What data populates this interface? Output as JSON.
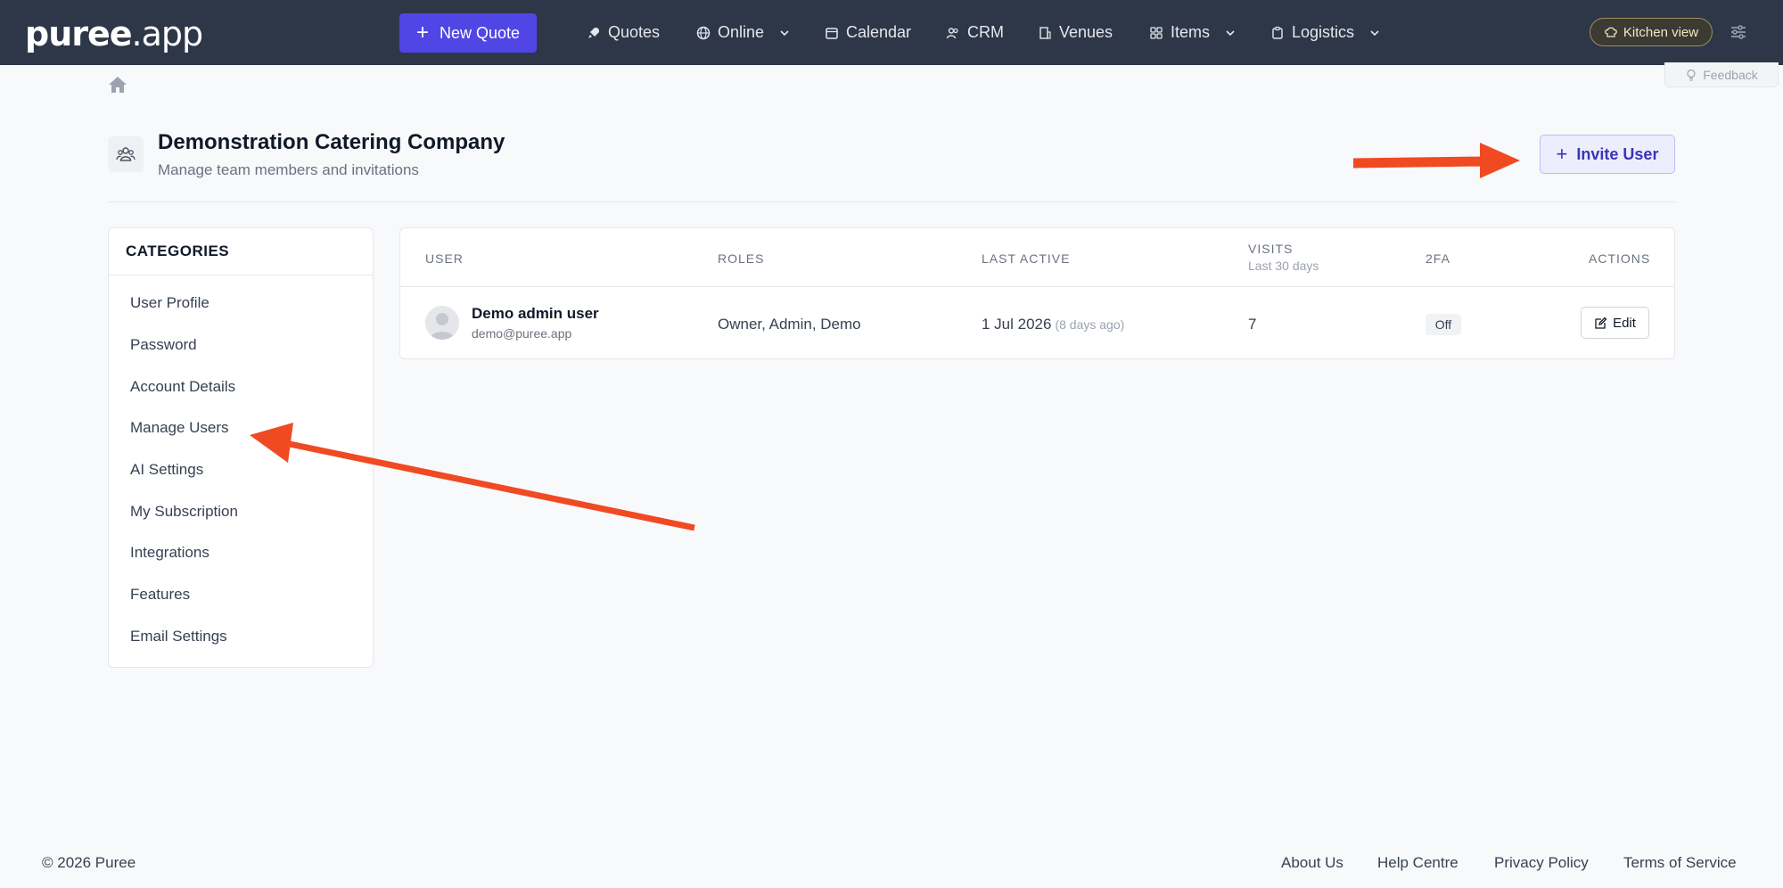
{
  "brand": {
    "logo_main": "puree",
    "logo_suffix": ".app"
  },
  "nav": {
    "new_quote": "New Quote",
    "items": [
      {
        "label": "Quotes",
        "icon": "rocket-icon"
      },
      {
        "label": "Online",
        "icon": "globe-icon",
        "dropdown": true
      },
      {
        "label": "Calendar",
        "icon": "calendar-icon"
      },
      {
        "label": "CRM",
        "icon": "users-icon"
      },
      {
        "label": "Venues",
        "icon": "building-icon"
      },
      {
        "label": "Items",
        "icon": "grid-icon",
        "dropdown": true
      },
      {
        "label": "Logistics",
        "icon": "clipboard-icon",
        "dropdown": true
      }
    ],
    "kitchen_view": "Kitchen view"
  },
  "feedback": "Feedback",
  "header": {
    "title": "Demonstration Catering Company",
    "subtitle": "Manage team members and invitations",
    "invite_button": "Invite User"
  },
  "categories": {
    "heading": "CATEGORIES",
    "items": [
      "User Profile",
      "Password",
      "Account Details",
      "Manage Users",
      "AI Settings",
      "My Subscription",
      "Integrations",
      "Features",
      "Email Settings"
    ]
  },
  "table": {
    "headers": {
      "user": "USER",
      "roles": "ROLES",
      "last_active": "LAST ACTIVE",
      "visits": "VISITS",
      "visits_sub": "Last 30 days",
      "twofa": "2FA",
      "actions": "ACTIONS"
    },
    "rows": [
      {
        "name": "Demo admin user",
        "email": "demo@puree.app",
        "roles": "Owner, Admin, Demo",
        "last_active": "1 Jul 2026",
        "last_active_ago": "(8 days ago)",
        "visits": "7",
        "twofa": "Off",
        "action": "Edit"
      }
    ]
  },
  "footer": {
    "copyright": "© 2026 Puree",
    "links": [
      "About Us",
      "Help Centre",
      "Privacy Policy",
      "Terms of Service"
    ]
  },
  "colors": {
    "nav_bg": "#2d3748",
    "primary": "#5046e5",
    "annotation_arrow": "#f04a23"
  }
}
